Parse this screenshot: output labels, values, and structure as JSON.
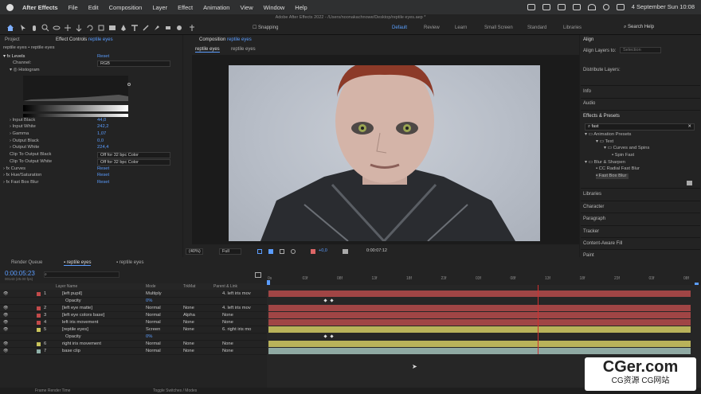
{
  "menubar": {
    "app": "After Effects",
    "items": [
      "File",
      "Edit",
      "Composition",
      "Layer",
      "Effect",
      "Animation",
      "View",
      "Window",
      "Help"
    ],
    "datetime": "4 September Sun  10:08"
  },
  "window_title": "Adobe After Effects 2022 - /Users/noonakachnowe/Desktop/reptile eyes.aep *",
  "toolbar": {
    "snapping": "Snapping",
    "workspaces": [
      "Default",
      "Review",
      "Learn",
      "Small Screen",
      "Standard",
      "Libraries"
    ],
    "active_workspace": "Default",
    "search_placeholder": "Search Help"
  },
  "effect_controls": {
    "tab_project": "Project",
    "tab_label": "Effect Controls",
    "tab_layer": "reptile eyes",
    "breadcrumb": "reptile eyes • reptile eyes",
    "levels": "Levels",
    "reset": "Reset",
    "channel_label": "Channel:",
    "channel_value": "RGB",
    "histogram": "Histogram",
    "params": [
      {
        "label": "Input Black",
        "value": "44,0"
      },
      {
        "label": "Input White",
        "value": "242,2"
      },
      {
        "label": "Gamma",
        "value": "1,07"
      },
      {
        "label": "Output Black",
        "value": "0,0"
      },
      {
        "label": "Output White",
        "value": "224,4"
      }
    ],
    "clip_black_label": "Clip To Output Black",
    "clip_white_label": "Clip To Output White",
    "clip_value": "Off for 32 bpc Color",
    "other_effects": [
      {
        "label": "Curves",
        "reset": "Reset"
      },
      {
        "label": "Hue/Saturation",
        "reset": "Reset"
      },
      {
        "label": "Fast Box Blur",
        "reset": "Reset"
      }
    ]
  },
  "composition": {
    "tab_label": "Composition",
    "tab_name": "reptile eyes",
    "subtabs": [
      "reptile eyes",
      "reptile eyes"
    ],
    "zoom": "(40%)",
    "quality": "Full",
    "exposure": "+0,0",
    "timecode": "0:00:07:12"
  },
  "right_panels": {
    "align": "Align",
    "align_layers_to": "Align Layers to:",
    "align_selection": "Selection",
    "distribute_layers": "Distribute Layers:",
    "info": "Info",
    "audio": "Audio",
    "effects_presets": "Effects & Presets",
    "search_value": "fast",
    "tree": [
      "Animation Presets",
      "Text",
      "Curves and Spins",
      "Spin Fast",
      "Blur & Sharpen",
      "CC Radial Fast Blur",
      "Fast Box Blur"
    ],
    "libraries": "Libraries",
    "character": "Character",
    "paragraph": "Paragraph",
    "tracker": "Tracker",
    "content_aware_fill": "Content-Aware Fill",
    "paint": "Paint"
  },
  "timeline": {
    "tab_render_queue": "Render Queue",
    "tab_comp": "reptile eyes",
    "tab_comp2": "reptile eyes",
    "timecode": "0:00:05:23",
    "frames": "00143 (25.00 fps)",
    "headers": {
      "layer_name": "Layer Name",
      "mode": "Mode",
      "trkmat": "TrkMat",
      "parent": "Parent & Link"
    },
    "ruler_ticks": [
      "0s",
      "03f",
      "08f",
      "13f",
      "18f",
      "23f",
      "03f",
      "08f",
      "13f",
      "18f",
      "23f",
      "03f",
      "08f"
    ],
    "layers": [
      {
        "num": "1",
        "name": "[left pupil]",
        "mode": "Multiply",
        "trkmat": "",
        "parent": "4. left iris mov",
        "color": "#c24a4a"
      },
      {
        "num": "",
        "name": "Opacity",
        "mode": "0%",
        "trkmat": "",
        "parent": "",
        "color": ""
      },
      {
        "num": "2",
        "name": "[left eye matte]",
        "mode": "Normal",
        "trkmat": "None",
        "parent": "4. left iris mov",
        "color": "#c24a4a"
      },
      {
        "num": "3",
        "name": "[left eye colors base]",
        "mode": "Normal",
        "trkmat": "Alpha",
        "parent": "None",
        "color": "#c24a4a"
      },
      {
        "num": "4",
        "name": "left iris movement",
        "mode": "Normal",
        "trkmat": "None",
        "parent": "None",
        "color": "#c24a4a"
      },
      {
        "num": "5",
        "name": "[reptile eyes]",
        "mode": "Screen",
        "trkmat": "None",
        "parent": "6. right iris mo",
        "color": "#c9c45a"
      },
      {
        "num": "",
        "name": "Opacity",
        "mode": "0%",
        "trkmat": "",
        "parent": "",
        "color": ""
      },
      {
        "num": "6",
        "name": "right iris movement",
        "mode": "Normal",
        "trkmat": "None",
        "parent": "None",
        "color": "#c9c45a"
      },
      {
        "num": "7",
        "name": "base clip",
        "mode": "Normal",
        "trkmat": "None",
        "parent": "None",
        "color": "#8fb0a8"
      }
    ],
    "footer_left": "Frame Render Time",
    "footer_mid": "Toggle Switches / Modes"
  },
  "watermark": {
    "line1": "CGer.com",
    "line2": "CG资源 CG网站"
  }
}
